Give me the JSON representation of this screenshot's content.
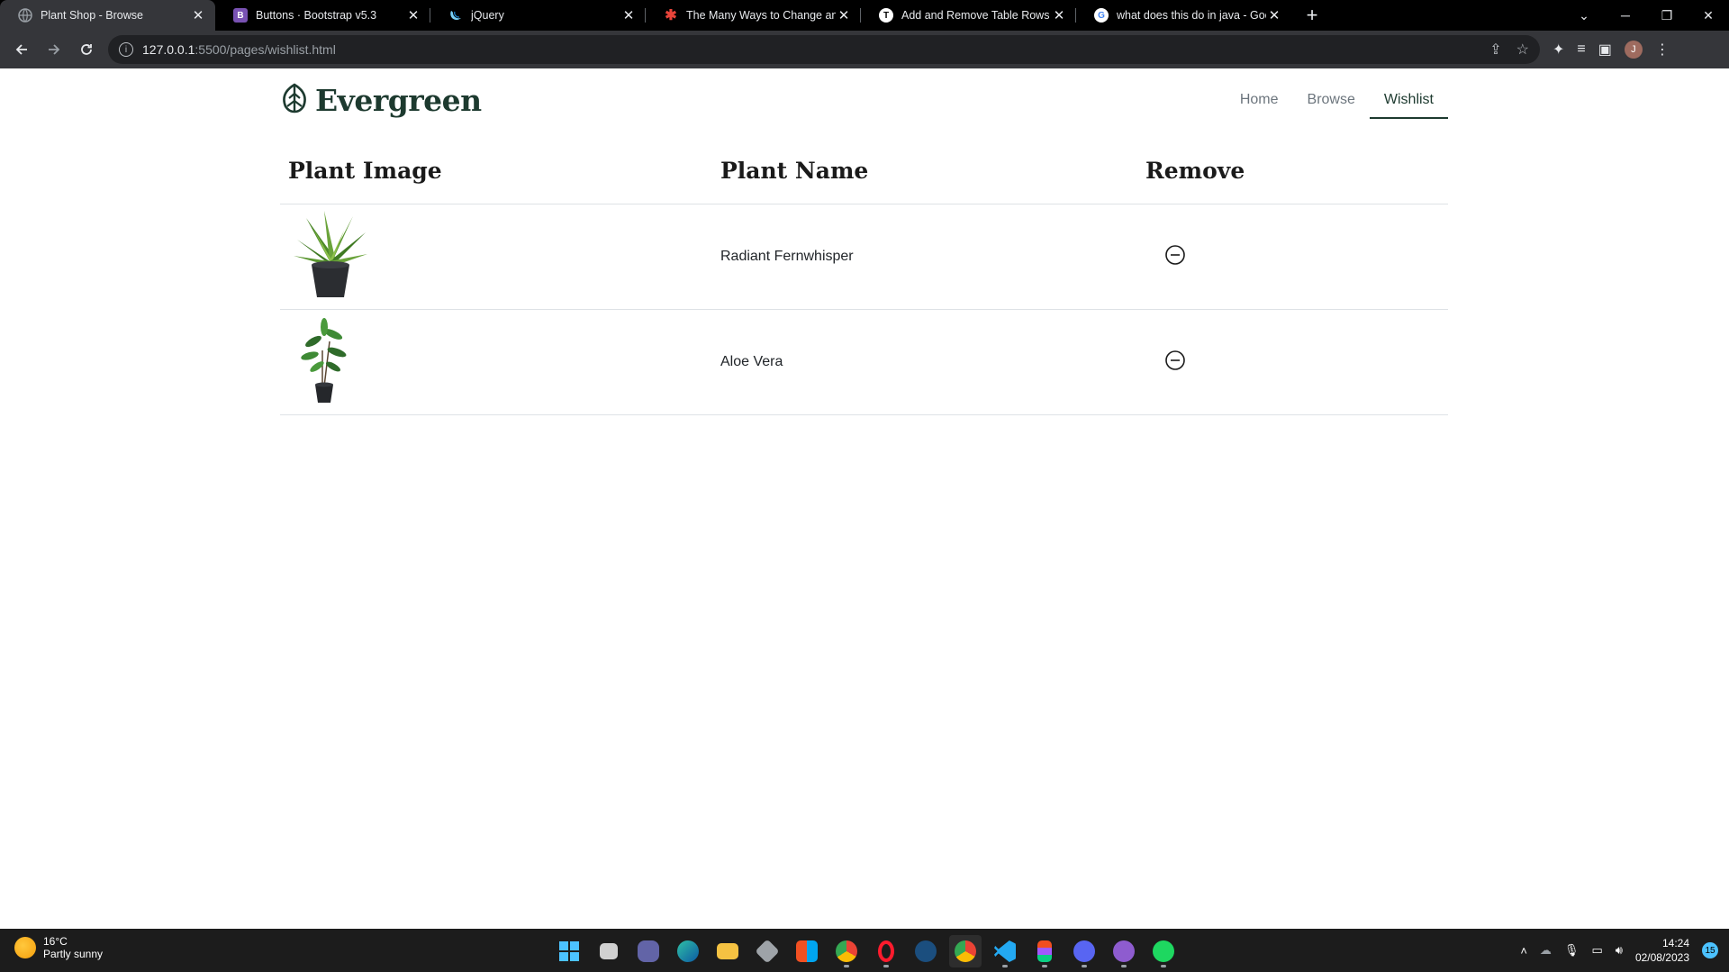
{
  "browser": {
    "tabs": [
      {
        "title": "Plant Shop - Browse",
        "active": true,
        "favicon": "globe-icon",
        "favicon_color": "#9aa0a6"
      },
      {
        "title": "Buttons · Bootstrap v5.3",
        "favicon": "bootstrap-icon",
        "favicon_color": "#7952b3",
        "favicon_text": "B"
      },
      {
        "title": "jQuery",
        "favicon": "jquery-icon",
        "favicon_color": "#0769ad"
      },
      {
        "title": "The Many Ways to Change an SV",
        "favicon": "css-tricks-icon",
        "favicon_color": "#e8443a"
      },
      {
        "title": "Add and Remove Table Rows Dy",
        "favicon": "site-icon",
        "favicon_color": "#ffffff",
        "favicon_text": "T"
      },
      {
        "title": "what does this do in java - Goog",
        "favicon": "google-icon",
        "favicon_color": "#ffffff",
        "favicon_text": "G"
      }
    ],
    "url_host": "127.0.0.1",
    "url_rest": ":5500/pages/wishlist.html",
    "profile_initial": "J"
  },
  "site": {
    "brand": "Evergreen",
    "nav": [
      {
        "label": "Home",
        "active": false
      },
      {
        "label": "Browse",
        "active": false
      },
      {
        "label": "Wishlist",
        "active": true
      }
    ],
    "accent_color": "#1d3a2f"
  },
  "wishlist": {
    "headers": {
      "image": "Plant Image",
      "name": "Plant Name",
      "remove": "Remove"
    },
    "rows": [
      {
        "name": "Radiant Fernwhisper",
        "image": "plant-image-agave"
      },
      {
        "name": "Aloe Vera",
        "image": "plant-image-dracaena"
      }
    ]
  },
  "taskbar": {
    "weather_temp": "16°C",
    "weather_desc": "Partly sunny",
    "time": "14:24",
    "date": "02/08/2023",
    "notification_count": "15"
  }
}
